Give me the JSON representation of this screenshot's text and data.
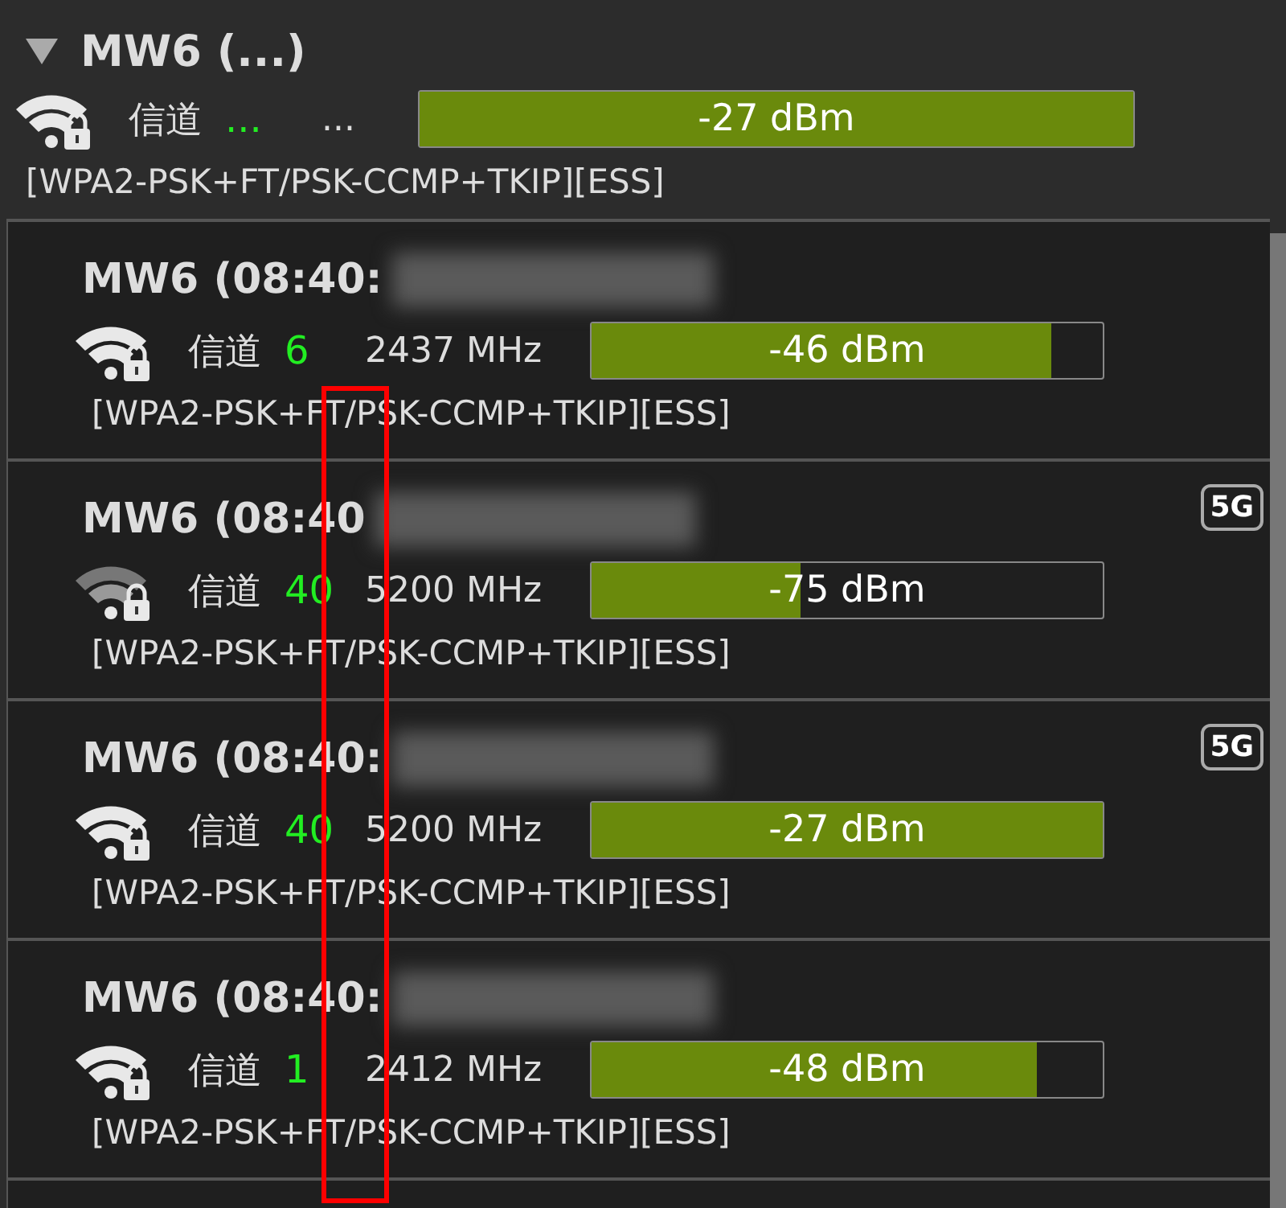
{
  "group": {
    "title": "MW6 (...)",
    "expanded": true,
    "channel_label": "信道",
    "channel": "...",
    "frequency": "...",
    "level": 1.0,
    "reading": "-27 dBm",
    "security": "[WPA2-PSK+FT/PSK-CCMP+TKIP][ESS]"
  },
  "networks": [
    {
      "title": "MW6 (08:40:",
      "channel_label": "信道",
      "channel": "6",
      "frequency": "2437 MHz",
      "level": 0.9,
      "reading": "-46 dBm",
      "security": "[WPA2-PSK+FT/PSK-CCMP+TKIP][ESS]"
    },
    {
      "title": "MW6 (08:40",
      "channel_label": "信道",
      "channel": "40",
      "frequency": "5200 MHz",
      "level": 0.41,
      "reading": "-75 dBm",
      "security": "[WPA2-PSK+FT/PSK-CCMP+TKIP][ESS]",
      "badge": "5G"
    },
    {
      "title": "MW6 (08:40:",
      "channel_label": "信道",
      "channel": "40",
      "frequency": "5200 MHz",
      "level": 1.0,
      "reading": "-27 dBm",
      "security": "[WPA2-PSK+FT/PSK-CCMP+TKIP][ESS]",
      "badge": "5G"
    },
    {
      "title": "MW6 (08:40:",
      "channel_label": "信道",
      "channel": "1",
      "frequency": "2412 MHz",
      "level": 0.87,
      "reading": "-48 dBm",
      "security": "[WPA2-PSK+FT/PSK-CCMP+TKIP][ESS]"
    }
  ]
}
